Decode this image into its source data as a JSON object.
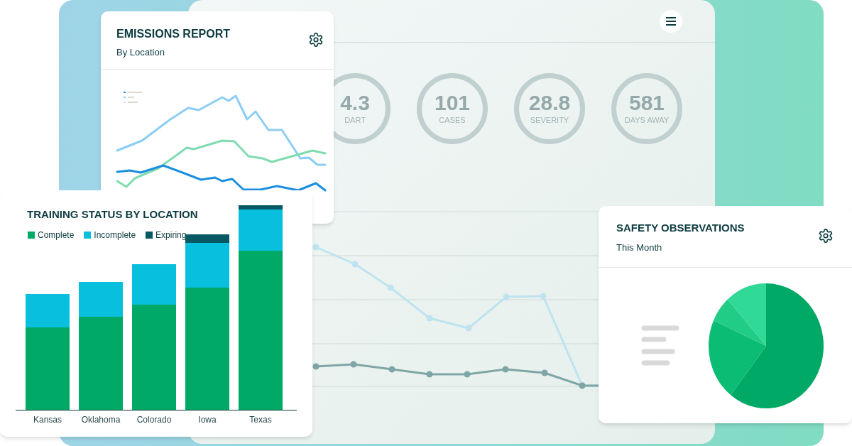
{
  "stats": [
    {
      "value": "4.3",
      "label": "DART"
    },
    {
      "value": "101",
      "label": "CASES"
    },
    {
      "value": "28.8",
      "label": "SEVERITY"
    },
    {
      "value": "581",
      "label": "DAYS AWAY"
    }
  ],
  "emissions_report": {
    "title": "EMISSIONS REPORT",
    "subtitle": "By Location"
  },
  "training_status": {
    "title": "TRAINING STATUS BY LOCATION",
    "legend": [
      {
        "label": "Complete",
        "color": "#00aa66"
      },
      {
        "label": "Incomplete",
        "color": "#08bfdd"
      },
      {
        "label": "Expiring",
        "color": "#075a63"
      }
    ],
    "categories": [
      "Kansas",
      "Oklahoma",
      "Colorado",
      "Iowa",
      "Texas"
    ]
  },
  "safety_observations": {
    "title": "SAFETY OBSERVATIONS",
    "subtitle": "This Month"
  }
}
